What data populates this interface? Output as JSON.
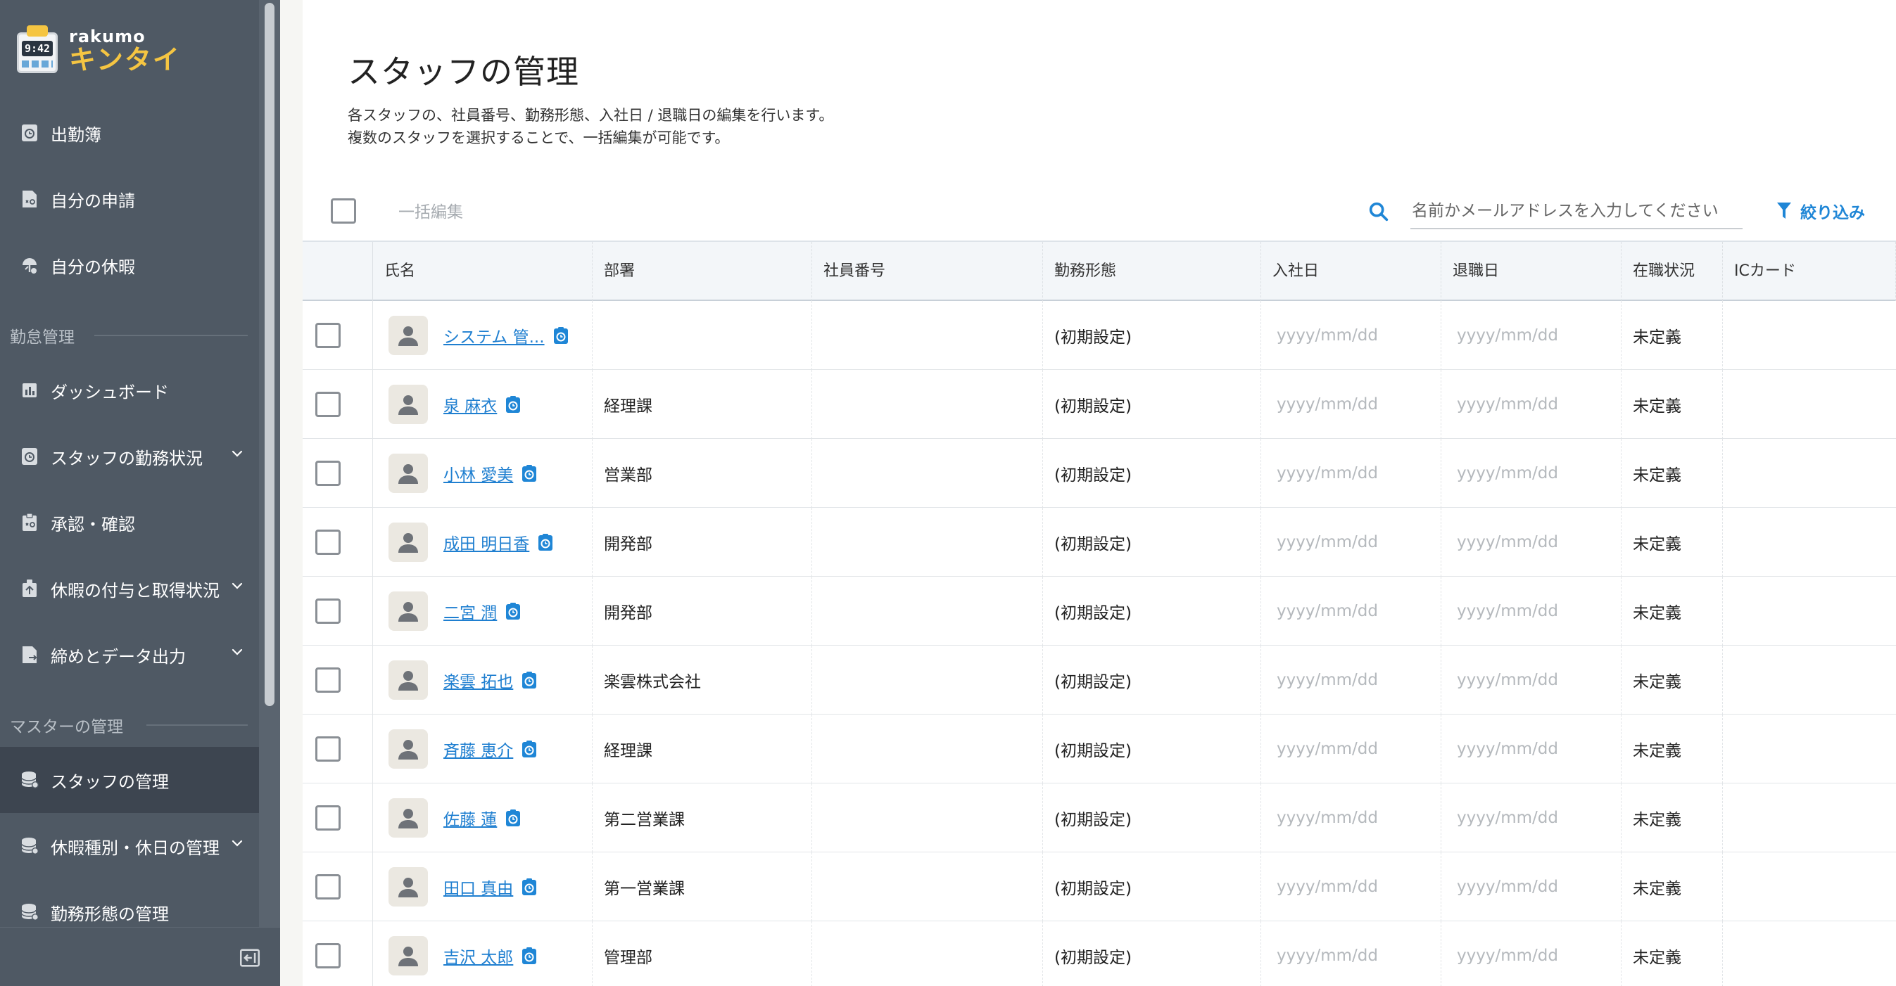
{
  "app": {
    "brand": "rakumo",
    "product": "キンタイ",
    "logo_time": "9:42"
  },
  "sidebar": {
    "items_top": [
      {
        "label": "出勤簿",
        "icon": "clock-book-icon"
      },
      {
        "label": "自分の申請",
        "icon": "request-doc-icon"
      },
      {
        "label": "自分の休暇",
        "icon": "vacation-icon"
      }
    ],
    "section_attendance": "勤怠管理",
    "items_attendance": [
      {
        "label": "ダッシュボード",
        "icon": "chart-bar-icon",
        "has_chevron": false
      },
      {
        "label": "スタッフの勤務状況",
        "icon": "clock-book-icon",
        "has_chevron": true
      },
      {
        "label": "承認・確認",
        "icon": "approval-doc-icon",
        "has_chevron": false
      },
      {
        "label": "休暇の付与と取得状況",
        "icon": "gift-doc-icon",
        "has_chevron": true
      },
      {
        "label": "締めとデータ出力",
        "icon": "export-doc-icon",
        "has_chevron": true
      }
    ],
    "section_master": "マスターの管理",
    "items_master": [
      {
        "label": "スタッフの管理",
        "icon": "database-icon",
        "has_chevron": false,
        "active": true
      },
      {
        "label": "休暇種別・休日の管理",
        "icon": "database-icon",
        "has_chevron": true
      },
      {
        "label": "勤務形態の管理",
        "icon": "database-icon",
        "has_chevron": false
      }
    ]
  },
  "main": {
    "title": "スタッフの管理",
    "description_lines": [
      "各スタッフの、社員番号、勤務形態、入社日 / 退職日の編集を行います。",
      "複数のスタッフを選択することで、一括編集が可能です。"
    ],
    "bulk_edit_label": "一括編集",
    "search_placeholder": "名前かメールアドレスを入力してください",
    "filter_label": "絞り込み"
  },
  "table": {
    "columns": [
      "氏名",
      "部署",
      "社員番号",
      "勤務形態",
      "入社日",
      "退職日",
      "在職状況",
      "ICカード"
    ],
    "date_placeholder": "yyyy/mm/dd",
    "rows": [
      {
        "name": "システム 管...",
        "department": "",
        "employee_no": "",
        "work_style": "(初期設定)",
        "status": "未定義"
      },
      {
        "name": "泉 麻衣",
        "department": "経理課",
        "employee_no": "",
        "work_style": "(初期設定)",
        "status": "未定義"
      },
      {
        "name": "小林 愛美",
        "department": "営業部",
        "employee_no": "",
        "work_style": "(初期設定)",
        "status": "未定義"
      },
      {
        "name": "成田 明日香",
        "department": "開発部",
        "employee_no": "",
        "work_style": "(初期設定)",
        "status": "未定義"
      },
      {
        "name": "二宮 潤",
        "department": "開発部",
        "employee_no": "",
        "work_style": "(初期設定)",
        "status": "未定義"
      },
      {
        "name": "楽雲 拓也",
        "department": "楽雲株式会社",
        "employee_no": "",
        "work_style": "(初期設定)",
        "status": "未定義"
      },
      {
        "name": "斉藤 恵介",
        "department": "経理課",
        "employee_no": "",
        "work_style": "(初期設定)",
        "status": "未定義"
      },
      {
        "name": "佐藤 蓮",
        "department": "第二営業課",
        "employee_no": "",
        "work_style": "(初期設定)",
        "status": "未定義"
      },
      {
        "name": "田口 真由",
        "department": "第一営業課",
        "employee_no": "",
        "work_style": "(初期設定)",
        "status": "未定義"
      },
      {
        "name": "吉沢 太郎",
        "department": "管理部",
        "employee_no": "",
        "work_style": "(初期設定)",
        "status": "未定義"
      }
    ]
  },
  "colors": {
    "sidebar_bg": "#4f5964",
    "sidebar_active": "#3d4550",
    "link_blue": "#1f7fd0",
    "accent_yellow": "#f5c542"
  }
}
